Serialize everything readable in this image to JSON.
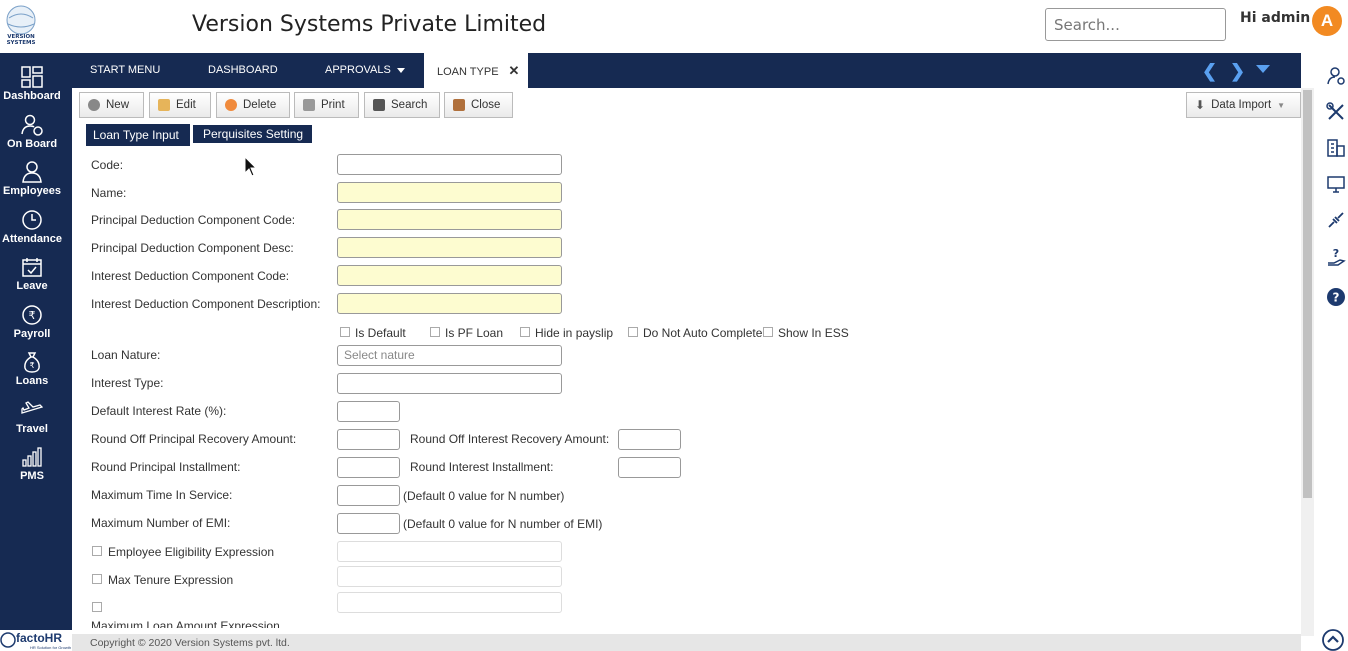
{
  "header": {
    "company": "Version Systems Private Limited",
    "search_placeholder": "Search...",
    "greeting": "Hi admin",
    "avatar_letter": "A",
    "logo_text": "VERSION SYSTEMS",
    "logo_tagline": "Simplifying human life"
  },
  "sidebar": {
    "items": [
      {
        "label": "Dashboard",
        "icon": "dashboard-icon"
      },
      {
        "label": "On Board",
        "icon": "onboard-icon"
      },
      {
        "label": "Employees",
        "icon": "employees-icon"
      },
      {
        "label": "Attendance",
        "icon": "clock-icon"
      },
      {
        "label": "Leave",
        "icon": "calendar-icon"
      },
      {
        "label": "Payroll",
        "icon": "rupee-icon"
      },
      {
        "label": "Loans",
        "icon": "money-bag-icon"
      },
      {
        "label": "Travel",
        "icon": "plane-icon"
      },
      {
        "label": "PMS",
        "icon": "bar-chart-icon"
      }
    ],
    "brand": "factoHR",
    "brand_tagline": "HR Solution for Growth"
  },
  "nav": {
    "items": [
      "START MENU",
      "DASHBOARD",
      "APPROVALS",
      "LOAN TYPE"
    ]
  },
  "toolbar": {
    "new": "New",
    "edit": "Edit",
    "delete": "Delete",
    "print": "Print",
    "search": "Search",
    "close": "Close",
    "data_import": "Data Import"
  },
  "tabs": {
    "loan_type_input": "Loan Type Input",
    "perquisites": "Perquisites Setting"
  },
  "form": {
    "code": "Code:",
    "name": "Name:",
    "pdc_code": "Principal Deduction Component Code:",
    "pdc_desc": "Principal Deduction Component Desc:",
    "idc_code": "Interest Deduction Component Code:",
    "idc_desc": "Interest Deduction Component Description:",
    "is_default": "Is Default",
    "is_pf_loan": "Is PF Loan",
    "hide_payslip": "Hide in payslip",
    "no_autocomplete": "Do Not Auto Complete",
    "show_ess": "Show In ESS",
    "loan_nature": "Loan Nature:",
    "loan_nature_placeholder": "Select nature",
    "interest_type": "Interest Type:",
    "default_rate": "Default Interest Rate (%):",
    "roundoff_principal": "Round Off Principal Recovery Amount:",
    "roundoff_interest": "Round Off Interest Recovery Amount:",
    "round_principal_inst": "Round Principal Installment:",
    "round_interest_inst": "Round Interest Installment:",
    "max_time": "Maximum Time In Service:",
    "max_time_hint": "(Default 0 value for N number)",
    "max_emi": "Maximum Number of EMI:",
    "max_emi_hint": "(Default 0 value for N number of EMI)",
    "emp_elig": "Employee Eligibility Expression",
    "max_tenure": "Max Tenure Expression",
    "max_loan_amt": "Maximum Loan Amount Expression"
  },
  "footer": {
    "copyright": "Copyright © 2020 Version Systems pvt. ltd."
  },
  "colors": {
    "navy": "#162a52",
    "accent": "#f28a22",
    "required_bg": "#fdfcd0"
  }
}
